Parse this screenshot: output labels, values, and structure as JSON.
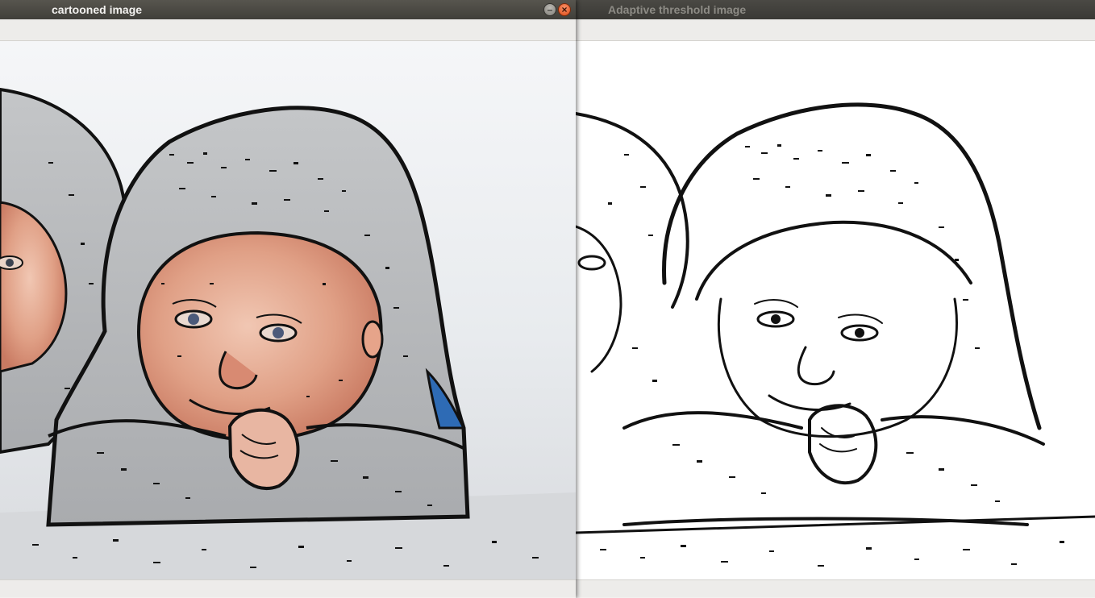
{
  "windows": {
    "left": {
      "title": "cartooned image"
    },
    "right": {
      "title": "Adaptive threshold image"
    }
  },
  "controls": {
    "minimize_glyph": "–",
    "close_glyph": "×"
  },
  "colors": {
    "titlebar_active": "#4d4b45",
    "titlebar_inactive": "#3c3b37",
    "close_button": "#df4b16",
    "hood_gray": "#b9bbbc",
    "skin": "#e2a28b",
    "sleeve_blue": "#2e6bb5",
    "ink": "#111111"
  }
}
